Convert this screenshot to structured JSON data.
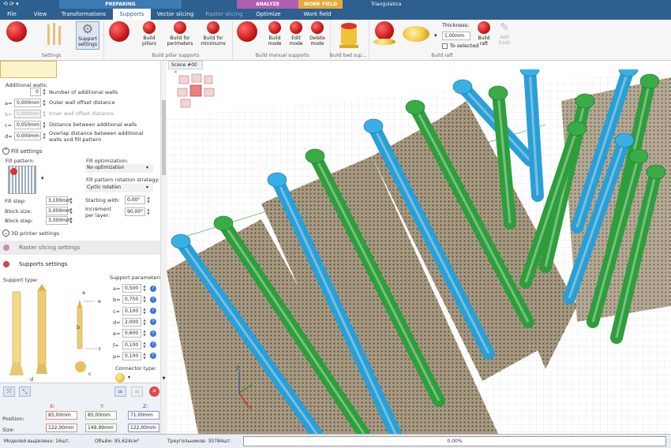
{
  "title_bar": {
    "context_tabs": [
      "PREPARING",
      "ANALYZE",
      "WORK FIELD"
    ],
    "app_title": "Triangulatica"
  },
  "menu": {
    "items": [
      "File",
      "View",
      "Transformations",
      "Supports",
      "Vector slicing",
      "Raster slicing",
      "Optimize",
      "Work field"
    ],
    "active": "Supports"
  },
  "ribbon": {
    "support_settings": "Support settings",
    "group_settings": "Settings",
    "build_pillars": "Build pillars",
    "build_for_perimeters": "Build for perimeters",
    "build_for_minimums": "Build for minimums",
    "group_pillar": "Build pillar supports",
    "build_mode": "Build mode",
    "edit_mode": "Edit mode",
    "delete_mode": "Delete mode",
    "group_manual": "Build manual supports",
    "group_bed": "Build bed sup...",
    "thickness_label": "Thickness:",
    "thickness_value": "1,00mm",
    "to_selected": "To selected",
    "build_raft": "Build raft",
    "add_hook": "Add hook",
    "group_raft": "Build raft"
  },
  "left_panel": {
    "additional_walls_label": "Additional walls:",
    "number_value": "0",
    "number_label": "Number of additional walls",
    "rows": [
      {
        "key": "a=",
        "value": "0,000mm",
        "label": "Outer wall offset distance",
        "disabled": false
      },
      {
        "key": "b=",
        "value": "0,000mm",
        "label": "Inner wall offset distance",
        "disabled": true
      },
      {
        "key": "c=",
        "value": "0,050mm",
        "label": "Distance between additional walls",
        "disabled": false
      },
      {
        "key": "d=",
        "value": "0,000mm",
        "label": "Overlap distance between additional walls and fill pattern",
        "disabled": false
      }
    ],
    "fill_settings": "Fill settings",
    "fill_pattern": "Fill pattern:",
    "fill_optimization_label": "Fill optimization:",
    "fill_optimization_value": "No optimization",
    "rotation_strategy_label": "Fill pattern rotation strategy:",
    "rotation_strategy_value": "Cyclic rotation",
    "fill_step_label": "Fill step:",
    "fill_step_value": "3,100mm",
    "block_size_label": "Block size:",
    "block_size_value": "3,000mm",
    "block_step_label": "Block step:",
    "block_step_value": "3,000mm",
    "starting_with_label": "Starting with:",
    "starting_with_value": "0,00°",
    "increment_label": "Increment per layer:",
    "increment_value": "90,00°",
    "printer_settings": "3D printer settings",
    "raster_settings": "Raster slicing settings",
    "supports_settings": "Supports settings",
    "support_type": "Support type:",
    "support_params": "Support parameters:",
    "params": [
      {
        "key": "a=",
        "value": "0,500"
      },
      {
        "key": "b=",
        "value": "0,750"
      },
      {
        "key": "c=",
        "value": "0,100"
      },
      {
        "key": "d=",
        "value": "2,000"
      },
      {
        "key": "e=",
        "value": "0,600"
      },
      {
        "key": "f=",
        "value": "0,100"
      },
      {
        "key": "p=",
        "value": "0,100"
      }
    ],
    "connector_type": "Connector type:",
    "letters": {
      "a": "a",
      "b": "b",
      "c": "c",
      "d": "d",
      "e": "e",
      "f": "f"
    },
    "xyz": {
      "x": "X:",
      "y": "Y:",
      "z": "Z:"
    },
    "position_label": "Position:",
    "position": [
      "85,00mm",
      "85,00mm",
      "71,00mm"
    ],
    "size_label": "Size:",
    "size": [
      "122,00mm",
      "149,99mm",
      "122,00mm"
    ]
  },
  "viewport": {
    "tab": "Scene #00",
    "close": "×",
    "axes": {
      "x": "X",
      "y": "Y",
      "z": "Z"
    }
  },
  "status": {
    "models_selected": "Моделей выделено: 16шт.",
    "volume": "Объём: 95,624см³",
    "triangles": "Треугольников: 30784шт.",
    "progress": "0.00%",
    "progress_value": 0.0
  },
  "colors": {
    "accent": "#2d5f8f",
    "blue_part": "#2a9fd6",
    "green_part": "#2e9e3c"
  }
}
